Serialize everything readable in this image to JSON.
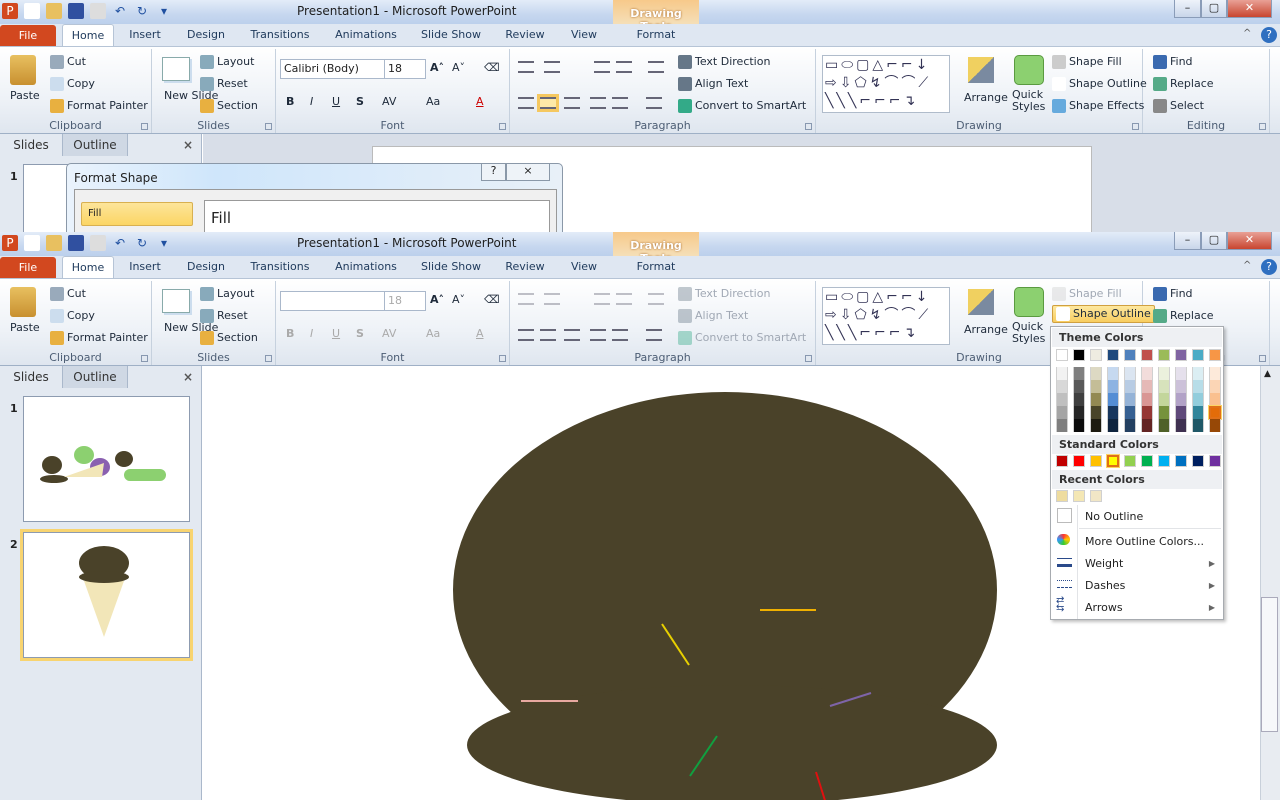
{
  "window_title": "Presentation1  -  Microsoft PowerPoint",
  "contextual_group": "Drawing Tools",
  "tabs": [
    "File",
    "Home",
    "Insert",
    "Design",
    "Transitions",
    "Animations",
    "Slide Show",
    "Review",
    "View",
    "Format"
  ],
  "active_tab": "Home",
  "ribbon": {
    "clipboard": {
      "label": "Clipboard",
      "paste": "Paste",
      "cut": "Cut",
      "copy": "Copy",
      "format_painter": "Format Painter"
    },
    "slides": {
      "label": "Slides",
      "new_slide": "New Slide",
      "layout": "Layout",
      "reset": "Reset",
      "section": "Section"
    },
    "font": {
      "label": "Font",
      "font_name": "Calibri (Body)",
      "font_size": "18",
      "bold": "B",
      "italic": "I",
      "underline": "U",
      "shadow": "S",
      "spacing": "AV",
      "case": "Aa",
      "color": "A"
    },
    "paragraph": {
      "label": "Paragraph",
      "text_direction": "Text Direction",
      "align_text": "Align Text",
      "convert_smartart": "Convert to SmartArt"
    },
    "drawing": {
      "label": "Drawing",
      "arrange": "Arrange",
      "quick_styles": "Quick Styles",
      "shape_fill": "Shape Fill",
      "shape_outline": "Shape Outline",
      "shape_effects": "Shape Effects"
    },
    "editing": {
      "label": "Editing",
      "find": "Find",
      "replace": "Replace",
      "select": "Select"
    }
  },
  "bottom_font_size": "18",
  "panel": {
    "tabs": [
      "Slides",
      "Outline"
    ],
    "close": "×",
    "slide_numbers": [
      "1",
      "2"
    ],
    "selected_slide": 2
  },
  "dialog": {
    "title": "Format Shape",
    "help": "?",
    "close": "×",
    "nav_selected": "Fill",
    "heading": "Fill"
  },
  "outline_menu": {
    "theme_header": "Theme Colors",
    "theme_colors": [
      "#FFFFFF",
      "#000000",
      "#EEECE1",
      "#1F497D",
      "#4F81BD",
      "#C0504D",
      "#9BBB59",
      "#8064A2",
      "#4BACC6",
      "#F79646"
    ],
    "theme_shades": [
      [
        "#F2F2F2",
        "#D8D8D8",
        "#BFBFBF",
        "#A5A5A5",
        "#7F7F7F"
      ],
      [
        "#7F7F7F",
        "#595959",
        "#3F3F3F",
        "#262626",
        "#0C0C0C"
      ],
      [
        "#DDD9C3",
        "#C4BD97",
        "#938953",
        "#494429",
        "#1D1B10"
      ],
      [
        "#C6D9F0",
        "#8DB3E2",
        "#548DD4",
        "#17365D",
        "#0F243E"
      ],
      [
        "#DBE5F1",
        "#B8CCE4",
        "#95B3D7",
        "#366092",
        "#244061"
      ],
      [
        "#F2DCDB",
        "#E5B9B7",
        "#D99694",
        "#953734",
        "#632423"
      ],
      [
        "#EBF1DD",
        "#D7E3BC",
        "#C3D69B",
        "#76923C",
        "#4F6128"
      ],
      [
        "#E5E0EC",
        "#CCC1D9",
        "#B2A2C7",
        "#5F497A",
        "#3F3151"
      ],
      [
        "#DBEEF3",
        "#B7DDE8",
        "#92CDDC",
        "#31859B",
        "#205867"
      ],
      [
        "#FDEADA",
        "#FBD5B5",
        "#FAC08F",
        "#E36C09",
        "#974806"
      ]
    ],
    "selected_theme": "#E36C09",
    "standard_header": "Standard Colors",
    "standard_colors": [
      "#C00000",
      "#FF0000",
      "#FFC000",
      "#FFFF00",
      "#92D050",
      "#00B050",
      "#00B0F0",
      "#0070C0",
      "#002060",
      "#7030A0"
    ],
    "selected_standard": "#FFFF00",
    "recent_header": "Recent Colors",
    "recent_colors": [
      "#EEDC9F",
      "#F4E7B4",
      "#F1E6C6"
    ],
    "no_outline": "No Outline",
    "more_colors": "More Outline Colors...",
    "weight": "Weight",
    "dashes": "Dashes",
    "arrows": "Arrows"
  },
  "slide": {
    "scoop_color": "#4A4229",
    "sprinkle_colors": [
      "#E8D000",
      "#F0B000",
      "#E8A8A0",
      "#7E64A8",
      "#10A040",
      "#E01010",
      "#E07010"
    ]
  }
}
